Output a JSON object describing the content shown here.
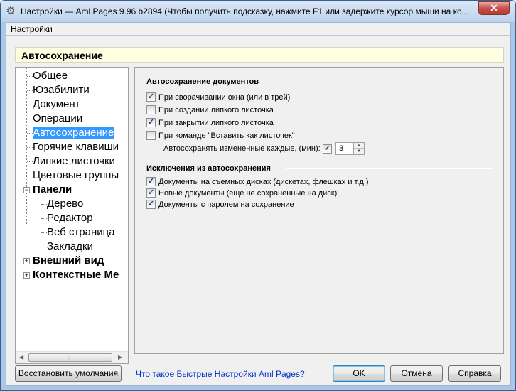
{
  "window": {
    "title": "Настройки  —  Aml Pages 9.96 b2894 (Чтобы получить подсказку, нажмите F1 или задержите курсор мыши на ко...",
    "close_glyph": "✕"
  },
  "menu": {
    "item": "Настройки"
  },
  "header": {
    "title": "Автосохранение"
  },
  "tree": {
    "items": [
      {
        "label": "Общее"
      },
      {
        "label": "Юзабилити"
      },
      {
        "label": "Документ"
      },
      {
        "label": "Операции"
      },
      {
        "label": "Автосохранение"
      },
      {
        "label": "Горячие клавиши"
      },
      {
        "label": "Липкие листочки"
      },
      {
        "label": "Цветовые группы"
      },
      {
        "label": "Панели"
      },
      {
        "label": "Дерево"
      },
      {
        "label": "Редактор"
      },
      {
        "label": "Веб страница"
      },
      {
        "label": "Закладки"
      },
      {
        "label": "Внешний вид"
      },
      {
        "label": "Контекстные Ме"
      }
    ],
    "expander_minus": "−",
    "expander_plus": "+",
    "scroll_left": "◀",
    "scroll_right": "▶",
    "scroll_grip": "|||"
  },
  "autosave_group": {
    "title": "Автосохранение документов",
    "options": [
      {
        "label": "При сворачивании окна (или в трей)",
        "checked": true
      },
      {
        "label": "При создании липкого листочка",
        "checked": false
      },
      {
        "label": "При закрытии липкого листочка",
        "checked": true
      },
      {
        "label": "При команде \"Вставить как листочек\"",
        "checked": false
      }
    ],
    "interval_label": "Автосохранять измененные каждые, (мин):",
    "interval_checked": true,
    "interval_value": "3",
    "spin_up": "▲",
    "spin_down": "▼"
  },
  "exclusions_group": {
    "title": "Исключения из автосохранения",
    "options": [
      {
        "label": "Документы на съемных дисках (дискетах, флешках и т.д.)",
        "checked": true
      },
      {
        "label": "Новые документы (еще не сохраненные на диск)",
        "checked": true
      },
      {
        "label": "Документы с паролем на сохранение",
        "checked": true
      }
    ]
  },
  "check_glyph": "✓",
  "footer": {
    "restore_label": "Восстановить умолчания",
    "help_link": "Что такое Быстрые Настройки Aml Pages?",
    "ok_label": "OK",
    "cancel_label": "Отмена",
    "help_label": "Справка"
  }
}
